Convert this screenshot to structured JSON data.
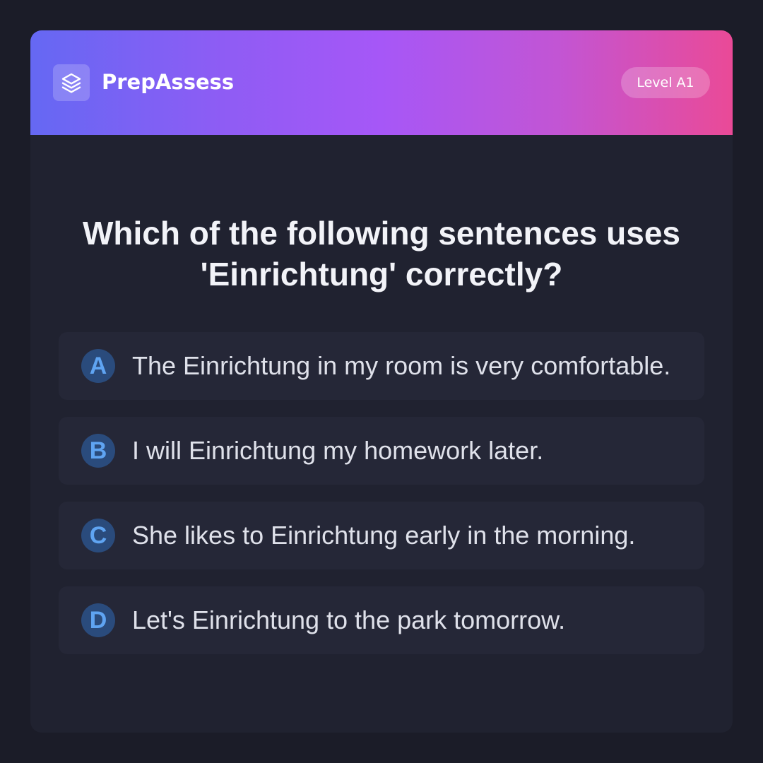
{
  "header": {
    "logo_icon": "layers-icon",
    "brand": "PrepAssess",
    "level_badge": "Level A1"
  },
  "question": {
    "text": "Which of the following sentences uses 'Einrichtung' correctly?"
  },
  "options": [
    {
      "letter": "A",
      "text": "The Einrichtung in my room is very comfortable."
    },
    {
      "letter": "B",
      "text": "I will Einrichtung my homework later."
    },
    {
      "letter": "C",
      "text": "She likes to Einrichtung early in the morning."
    },
    {
      "letter": "D",
      "text": "Let's Einrichtung to the park tomorrow."
    }
  ],
  "colors": {
    "page_background": "#1b1c28",
    "card_background": "#202230",
    "option_background": "#252737",
    "letter_badge_background": "#2a4b7c",
    "letter_color": "#5fa4f2",
    "header_gradient_start": "#6568f3",
    "header_gradient_mid": "#a657f7",
    "header_gradient_end": "#ea4a97"
  }
}
